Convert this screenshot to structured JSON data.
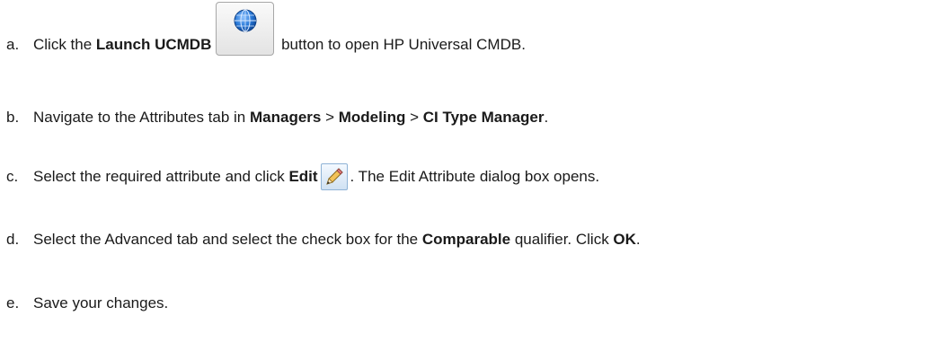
{
  "steps": [
    {
      "letter": "a.",
      "before": "Click the ",
      "bold": "Launch UCMDB",
      "after": " button to open HP Universal CMDB."
    },
    {
      "letter": "b.",
      "t1": "Navigate to the Attributes tab in ",
      "b1": "Managers",
      "t2": " > ",
      "b2": "Modeling",
      "t3": " > ",
      "b3": "CI Type Manager",
      "t4": "."
    },
    {
      "letter": "c.",
      "before": "Select the required attribute and click ",
      "bold": "Edit",
      "after": ". The Edit Attribute dialog box opens."
    },
    {
      "letter": "d.",
      "before": "Select the Advanced tab and select the check box for the ",
      "bold": "Comparable",
      "mid": " qualifier. Click ",
      "bold2": "OK",
      "after": "."
    },
    {
      "letter": "e.",
      "text": "Save your changes."
    }
  ],
  "icons": {
    "launch": "globe-icon",
    "edit": "pencil-icon"
  },
  "colors": {
    "text": "#1a1a1a",
    "globe": "#1f6fd1",
    "button_border": "#a7a7a7"
  }
}
